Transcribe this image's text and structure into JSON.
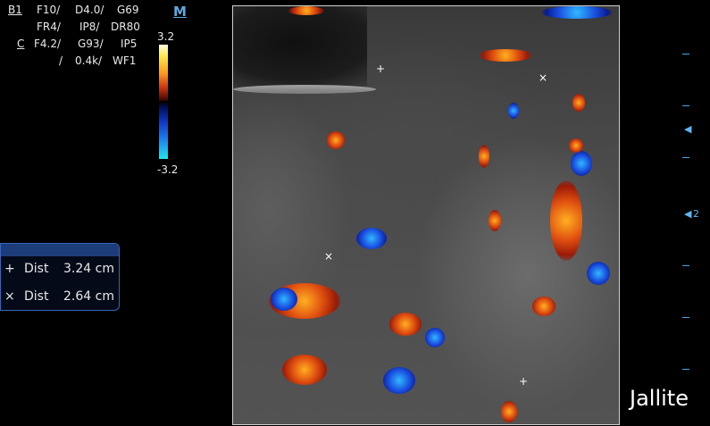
{
  "params": {
    "row1": [
      "B1",
      "F10/",
      "D4.0/",
      "G69"
    ],
    "row2": [
      "FR4/",
      "IP8/",
      "DR80"
    ],
    "row3": [
      "C",
      "F4.2/",
      "G93/",
      "IP5"
    ],
    "row4": [
      "/",
      "0.4k/",
      "WF1"
    ]
  },
  "mode_logo": "M",
  "color_scale": {
    "top": "3.2",
    "bottom": "-3.2"
  },
  "measurements": [
    {
      "symbol": "+",
      "label": "Dist",
      "value": "3.24 cm"
    },
    {
      "symbol": "×",
      "label": "Dist",
      "value": "2.64 cm"
    }
  ],
  "depth_label": "2",
  "focus_marker": "◀",
  "brand": "Jallite",
  "colors": {
    "accent": "#4aa0e0",
    "panel_header": "#1d3c7a",
    "doppler_red": "#e05010",
    "doppler_blue": "#1a50e0"
  },
  "markers": {
    "plus": "+",
    "cross": "×"
  }
}
